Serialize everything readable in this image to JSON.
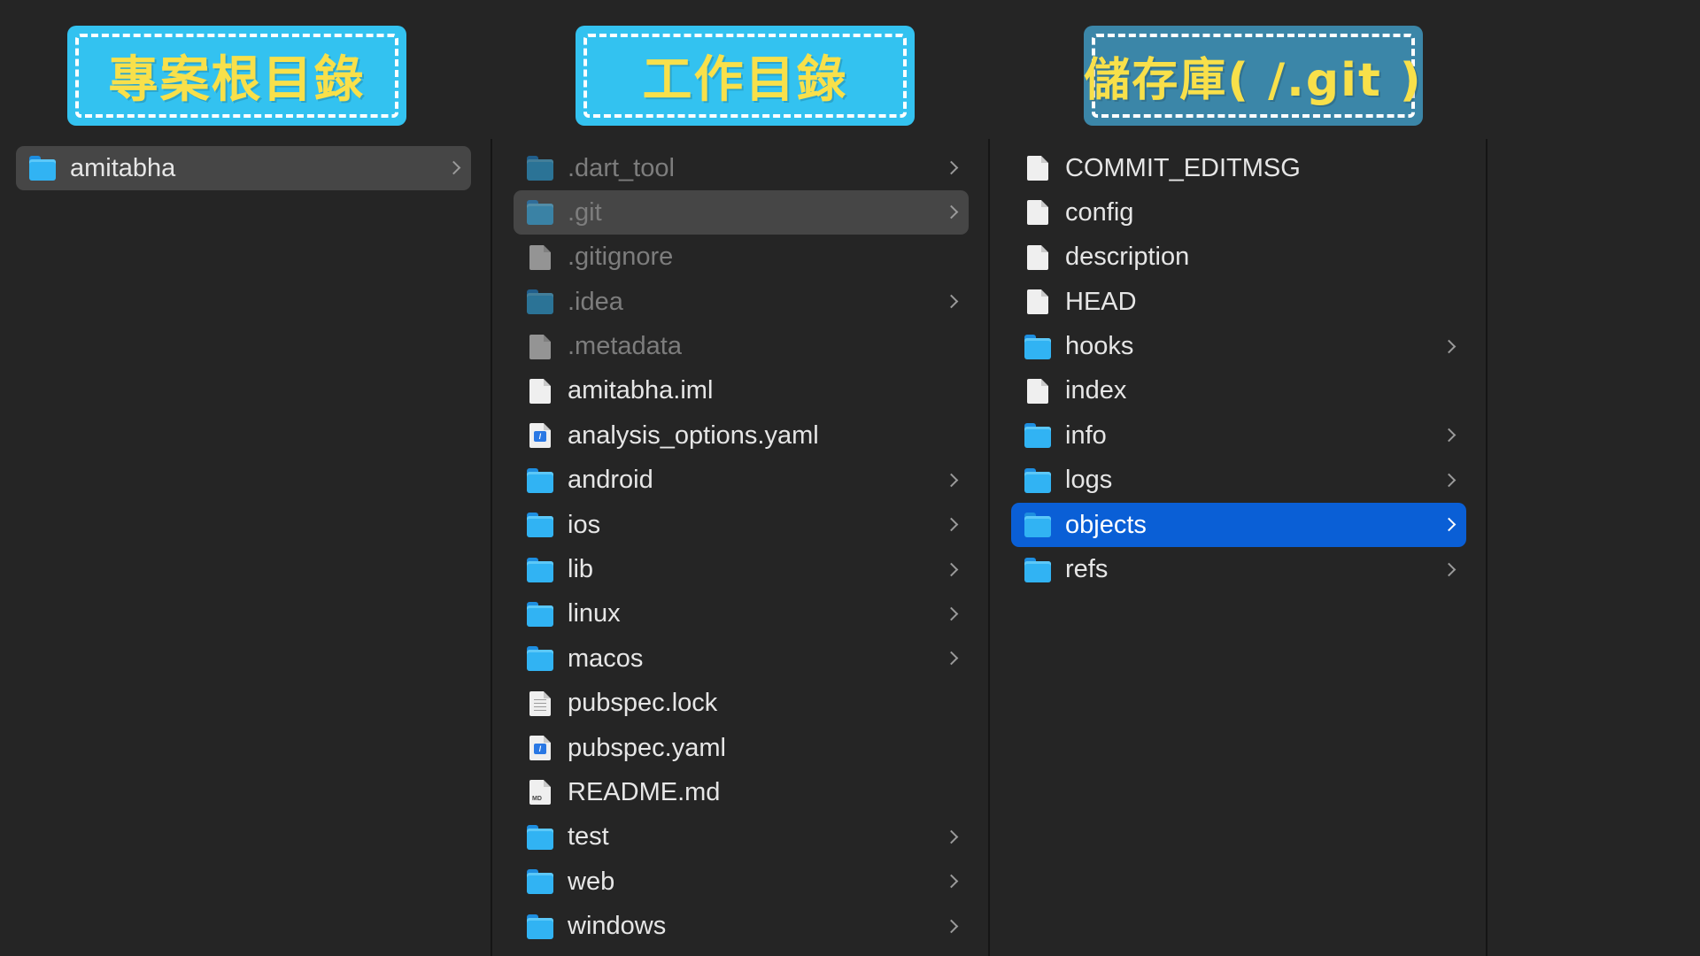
{
  "headers": {
    "root": "專案根目錄",
    "workdir": "工作目錄",
    "repo": "儲存庫( /.git )"
  },
  "colors": {
    "background": "#252525",
    "header_light": "#33c2f0",
    "header_dark": "#3b86a8",
    "header_text": "#f8e04a",
    "selection_blue": "#0a5fd6",
    "selection_grey": "#464646"
  },
  "columns": {
    "root": [
      {
        "name": "amitabha",
        "icon": "folder-icon",
        "chevron": true
      }
    ],
    "workdir": [
      {
        "name": ".dart_tool",
        "icon": "folder-icon",
        "chevron": true,
        "hidden": true
      },
      {
        "name": ".git",
        "icon": "folder-icon",
        "chevron": true,
        "hidden": true
      },
      {
        "name": ".gitignore",
        "icon": "file-icon",
        "chevron": false,
        "hidden": true
      },
      {
        "name": ".idea",
        "icon": "folder-icon",
        "chevron": true,
        "hidden": true
      },
      {
        "name": ".metadata",
        "icon": "file-icon",
        "chevron": false,
        "hidden": true
      },
      {
        "name": "amitabha.iml",
        "icon": "file-icon",
        "chevron": false
      },
      {
        "name": "analysis_options.yaml",
        "icon": "yaml-file-icon",
        "chevron": false
      },
      {
        "name": "android",
        "icon": "folder-icon",
        "chevron": true
      },
      {
        "name": "ios",
        "icon": "folder-icon",
        "chevron": true
      },
      {
        "name": "lib",
        "icon": "folder-icon",
        "chevron": true
      },
      {
        "name": "linux",
        "icon": "folder-icon",
        "chevron": true
      },
      {
        "name": "macos",
        "icon": "folder-icon",
        "chevron": true
      },
      {
        "name": "pubspec.lock",
        "icon": "text-file-icon",
        "chevron": false
      },
      {
        "name": "pubspec.yaml",
        "icon": "yaml-file-icon",
        "chevron": false
      },
      {
        "name": "README.md",
        "icon": "markdown-file-icon",
        "chevron": false
      },
      {
        "name": "test",
        "icon": "folder-icon",
        "chevron": true
      },
      {
        "name": "web",
        "icon": "folder-icon",
        "chevron": true
      },
      {
        "name": "windows",
        "icon": "folder-icon",
        "chevron": true
      }
    ],
    "repo": [
      {
        "name": "COMMIT_EDITMSG",
        "icon": "file-icon",
        "chevron": false
      },
      {
        "name": "config",
        "icon": "file-icon",
        "chevron": false
      },
      {
        "name": "description",
        "icon": "file-icon",
        "chevron": false
      },
      {
        "name": "HEAD",
        "icon": "file-icon",
        "chevron": false
      },
      {
        "name": "hooks",
        "icon": "folder-icon",
        "chevron": true
      },
      {
        "name": "index",
        "icon": "file-icon",
        "chevron": false
      },
      {
        "name": "info",
        "icon": "folder-icon",
        "chevron": true
      },
      {
        "name": "logs",
        "icon": "folder-icon",
        "chevron": true
      },
      {
        "name": "objects",
        "icon": "folder-icon",
        "chevron": true
      },
      {
        "name": "refs",
        "icon": "folder-icon",
        "chevron": true
      }
    ]
  },
  "selection": {
    "root": "amitabha",
    "workdir": ".git",
    "repo": "objects"
  }
}
